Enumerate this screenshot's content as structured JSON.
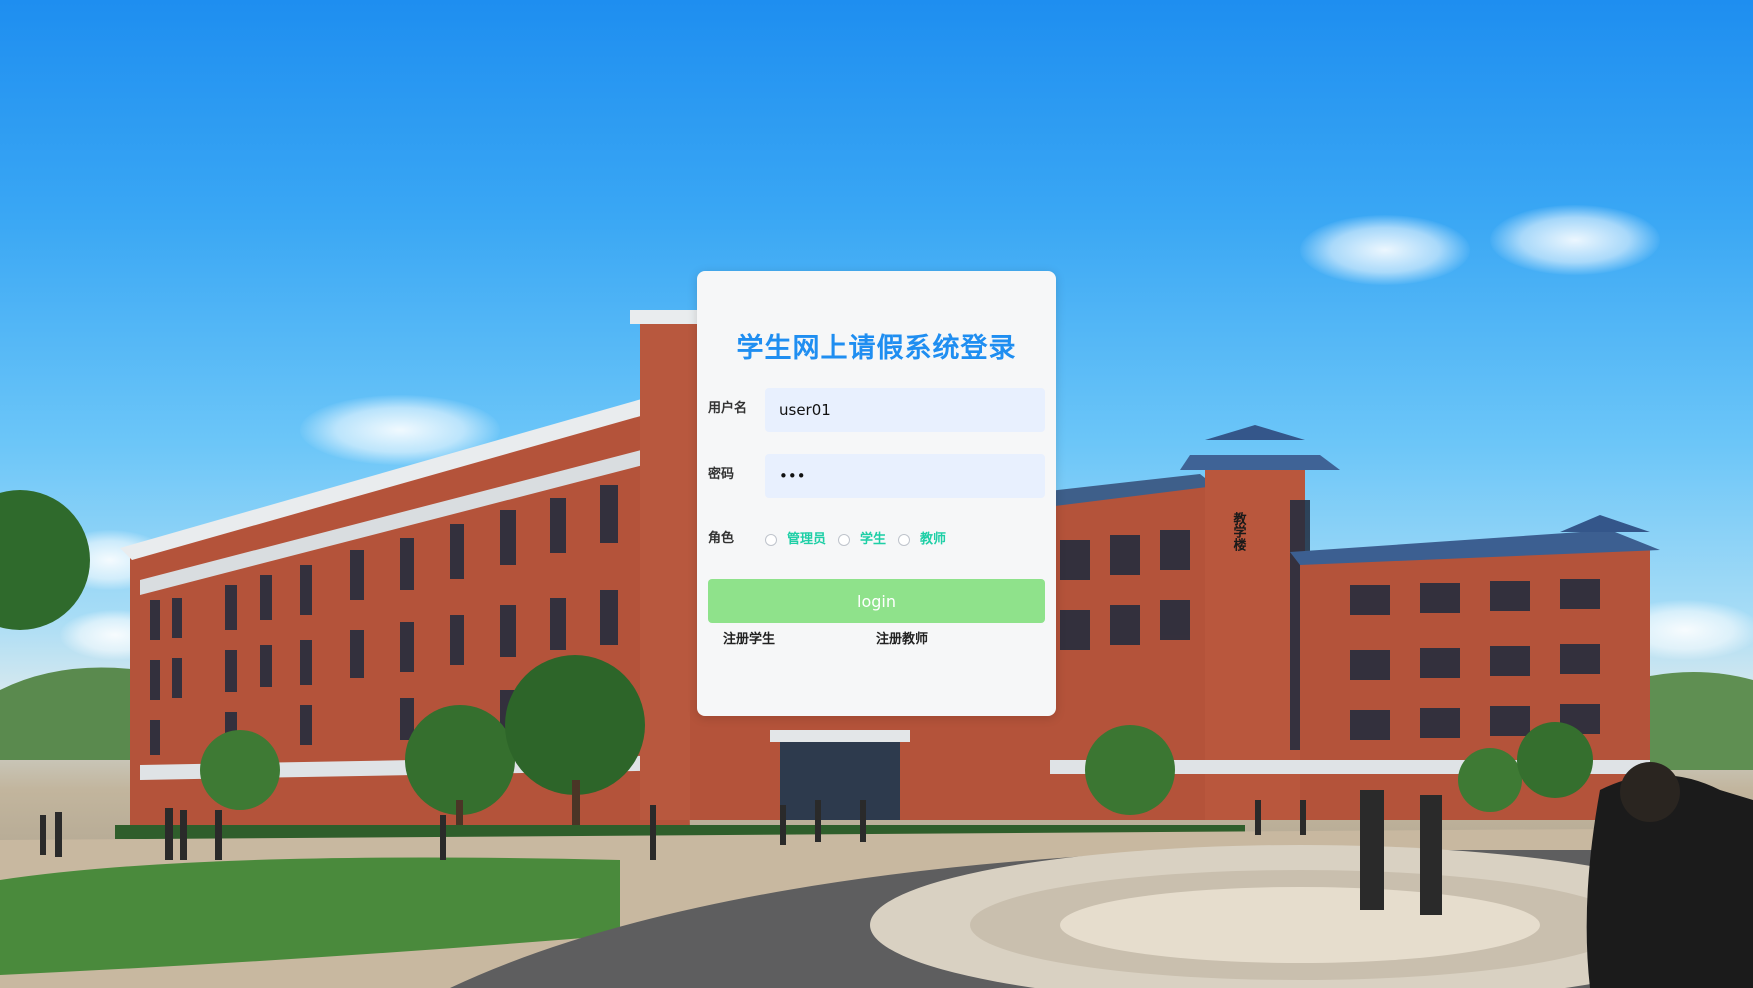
{
  "login": {
    "title": "学生网上请假系统登录",
    "username_label": "用户名",
    "username_value": "user01",
    "password_label": "密码",
    "password_value": "•••",
    "role_label": "角色",
    "roles": [
      {
        "label": "管理员",
        "selected": false
      },
      {
        "label": "学生",
        "selected": false
      },
      {
        "label": "教师",
        "selected": false
      }
    ],
    "login_button": "login",
    "register_student": "注册学生",
    "register_teacher": "注册教师"
  },
  "background": {
    "building_sign": "教学楼"
  },
  "colors": {
    "title": "#1f8ef1",
    "input_bg": "#e8f0fe",
    "role_label": "#1ecfa6",
    "login_button_bg": "#8fe28b",
    "card_bg": "#f6f7f8"
  }
}
